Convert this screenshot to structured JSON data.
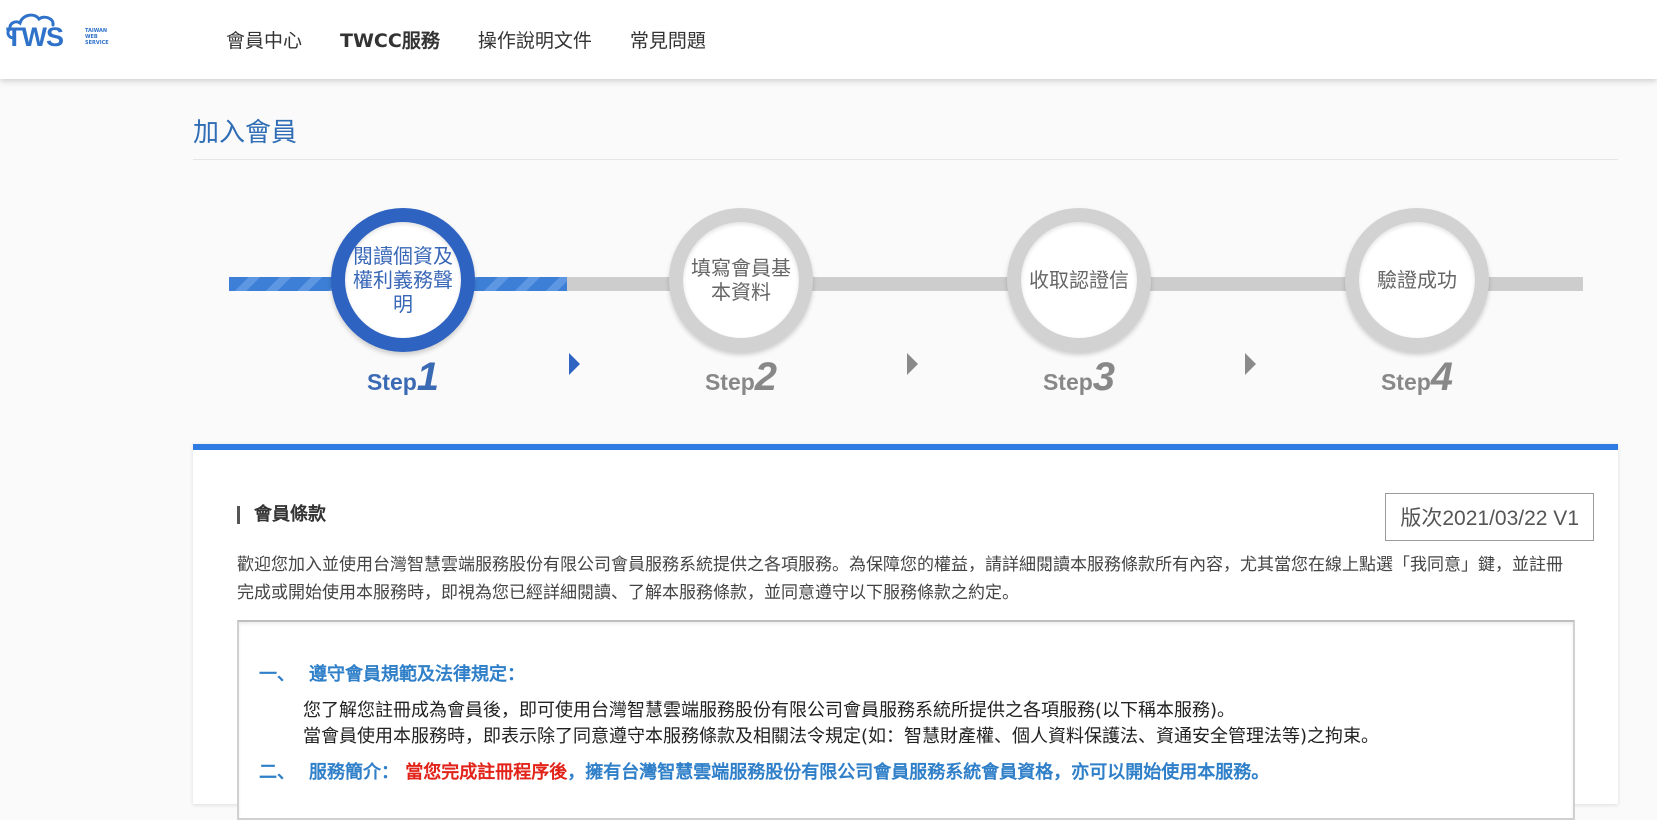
{
  "brand": {
    "logo_text": "TWS",
    "logo_sub": [
      "TAIWAN",
      "WEB",
      "SERVICE"
    ],
    "accent": "#2f72c9"
  },
  "nav": [
    {
      "label": "會員中心"
    },
    {
      "label": "TWCC服務"
    },
    {
      "label": "操作說明文件"
    },
    {
      "label": "常見問題"
    }
  ],
  "page": {
    "title": "加入會員"
  },
  "steps": {
    "progress": 0.25,
    "items": [
      {
        "label": "閱讀個資及權利義務聲明",
        "word": "Step",
        "num": "1",
        "active": true
      },
      {
        "label": "填寫會員基本資料",
        "word": "Step",
        "num": "2",
        "active": false
      },
      {
        "label": "收取認證信",
        "word": "Step",
        "num": "3",
        "active": false
      },
      {
        "label": "驗證成功",
        "word": "Step",
        "num": "4",
        "active": false
      }
    ]
  },
  "terms": {
    "section_title": "會員條款",
    "version": "版次2021/03/22 V1",
    "intro": "歡迎您加入並使用台灣智慧雲端服務股份有限公司會員服務系統提供之各項服務。為保障您的權益，請詳細閱讀本服務條款所有內容，尤其當您在線上點選「我同意」鍵，並註冊完成或開始使用本服務時，即視為您已經詳細閱讀、了解本服務條款，並同意遵守以下服務條款之約定。",
    "sections": [
      {
        "marker": "一、",
        "heading": "遵守會員規範及法律規定：",
        "paragraphs": [
          "您了解您註冊成為會員後，即可使用台灣智慧雲端服務股份有限公司會員服務系統所提供之各項服務(以下稱本服務)。",
          "當會員使用本服務時，即表示除了同意遵守本服務條款及相關法令規定(如：智慧財產權、個人資料保護法、資通安全管理法等)之拘束。"
        ]
      },
      {
        "marker": "二、",
        "heading": "服務簡介：",
        "highlight": "當您完成註冊程序後",
        "rest": "，擁有台灣智慧雲端服務股份有限公司會員服務系統會員資格，亦可以開始使用本服務。"
      }
    ]
  }
}
